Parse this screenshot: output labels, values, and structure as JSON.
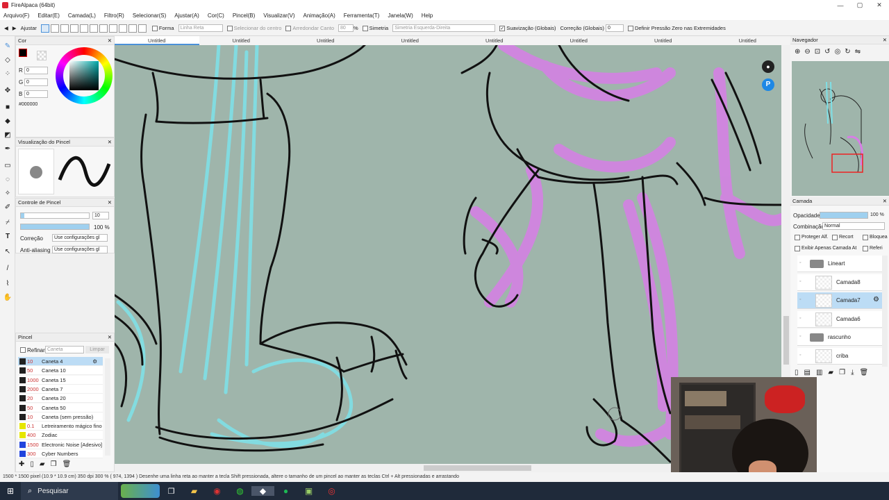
{
  "window": {
    "title": "FireAlpaca (64bit)"
  },
  "menu": [
    "Arquivo(F)",
    "Editar(E)",
    "Camada(L)",
    "Filtro(R)",
    "Selecionar(S)",
    "Ajustar(A)",
    "Cor(C)",
    "Pincel(B)",
    "Visualizar(V)",
    "Animação(A)",
    "Ferramenta(T)",
    "Janela(W)",
    "Help"
  ],
  "toolbar": {
    "ajustar": "Ajustar",
    "forma": "Forma",
    "forma_value": "Linha Reta",
    "selecionar_centro": "Selecionar do centro",
    "arredondar": "Arredondar Canto",
    "arredondar_value": "80",
    "pct": "%",
    "simetria": "Simetria",
    "simetria_value": "Simetria Esquerda-Direita",
    "suavizacao": "Suavização (Globais)",
    "correcao": "Correção (Globais)",
    "correcao_value": "0",
    "pressao": "Definir Pressão Zero nas Extremidades"
  },
  "tabs": [
    "Untitled",
    "Untitled",
    "Untitled",
    "Untitled",
    "Untitled",
    "Untitled",
    "Untitled",
    "Untitled"
  ],
  "color_panel": {
    "title": "Cor",
    "r_label": "R",
    "r": "0",
    "g_label": "G",
    "g": "0",
    "b_label": "B",
    "b": "0",
    "hex": "#000000"
  },
  "brush_preview": {
    "title": "Visualização do Pincel"
  },
  "brush_control": {
    "title": "Controle de Pincel",
    "size": "10",
    "opacity": "100 %",
    "correcao_label": "Correção",
    "correcao_value": "Use configurações gl",
    "antialias_label": "Anti-aliasing",
    "antialias_value": "Use configurações gl"
  },
  "brush_panel": {
    "title": "Pincel",
    "refinar": "Refinar",
    "search_placeholder": "Caneta",
    "limpar": "Limpar",
    "items": [
      {
        "size": "10",
        "name": "Caneta 4",
        "color": "#222222"
      },
      {
        "size": "50",
        "name": "Caneta 10",
        "color": "#222222"
      },
      {
        "size": "1000",
        "name": "Caneta 15",
        "color": "#222222"
      },
      {
        "size": "2000",
        "name": "Caneta 7",
        "color": "#222222"
      },
      {
        "size": "20",
        "name": "Caneta 20",
        "color": "#222222"
      },
      {
        "size": "50",
        "name": "Caneta 50",
        "color": "#222222"
      },
      {
        "size": "10",
        "name": "Caneta (sem pressão)",
        "color": "#222222"
      },
      {
        "size": "0.1",
        "name": "Letreiramento mágico fino",
        "color": "#e6e600"
      },
      {
        "size": "400",
        "name": "Zodiac",
        "color": "#e6e600"
      },
      {
        "size": "1500",
        "name": "Electronic Noise [Adesivo]",
        "color": "#2244dd"
      },
      {
        "size": "300",
        "name": "Cyber Numbers",
        "color": "#2244dd"
      }
    ]
  },
  "navigator": {
    "title": "Navegador"
  },
  "layer_panel": {
    "title": "Camada",
    "opacity_label": "Opacidade",
    "opacity_value": "100 %",
    "blend_label": "Combinação",
    "blend_value": "Normal",
    "proteger": "Proteger Alf.",
    "recorte": "Recort",
    "bloquear": "Bloquea",
    "exibir": "Exibir Apenas Camada At",
    "referencia": "Referi",
    "layers": [
      {
        "name": "Lineart",
        "type": "folder"
      },
      {
        "name": "Camada8",
        "type": "layer"
      },
      {
        "name": "Camada7",
        "type": "layer",
        "selected": true
      },
      {
        "name": "Camada6",
        "type": "layer"
      },
      {
        "name": "rascunho",
        "type": "folder"
      },
      {
        "name": "criba",
        "type": "layer"
      }
    ]
  },
  "status": {
    "text": "1500 * 1500 pixel  (10.9 * 10.9 cm)  350 dpi  300 %  ( 974, 1394 )  Desenhe uma linha reta ao manter a tecla Shift pressionada, altere o tamanho de um pincel ao manter as teclas Ctrl + Alt pressionadas e arrastando"
  },
  "taskbar": {
    "search": "Pesquisar"
  },
  "colors": {
    "canvas_bg": "#9fb5ab",
    "pink": "#d77ee6",
    "cyan": "#7fe0e6",
    "accent": "#4a90d9"
  }
}
